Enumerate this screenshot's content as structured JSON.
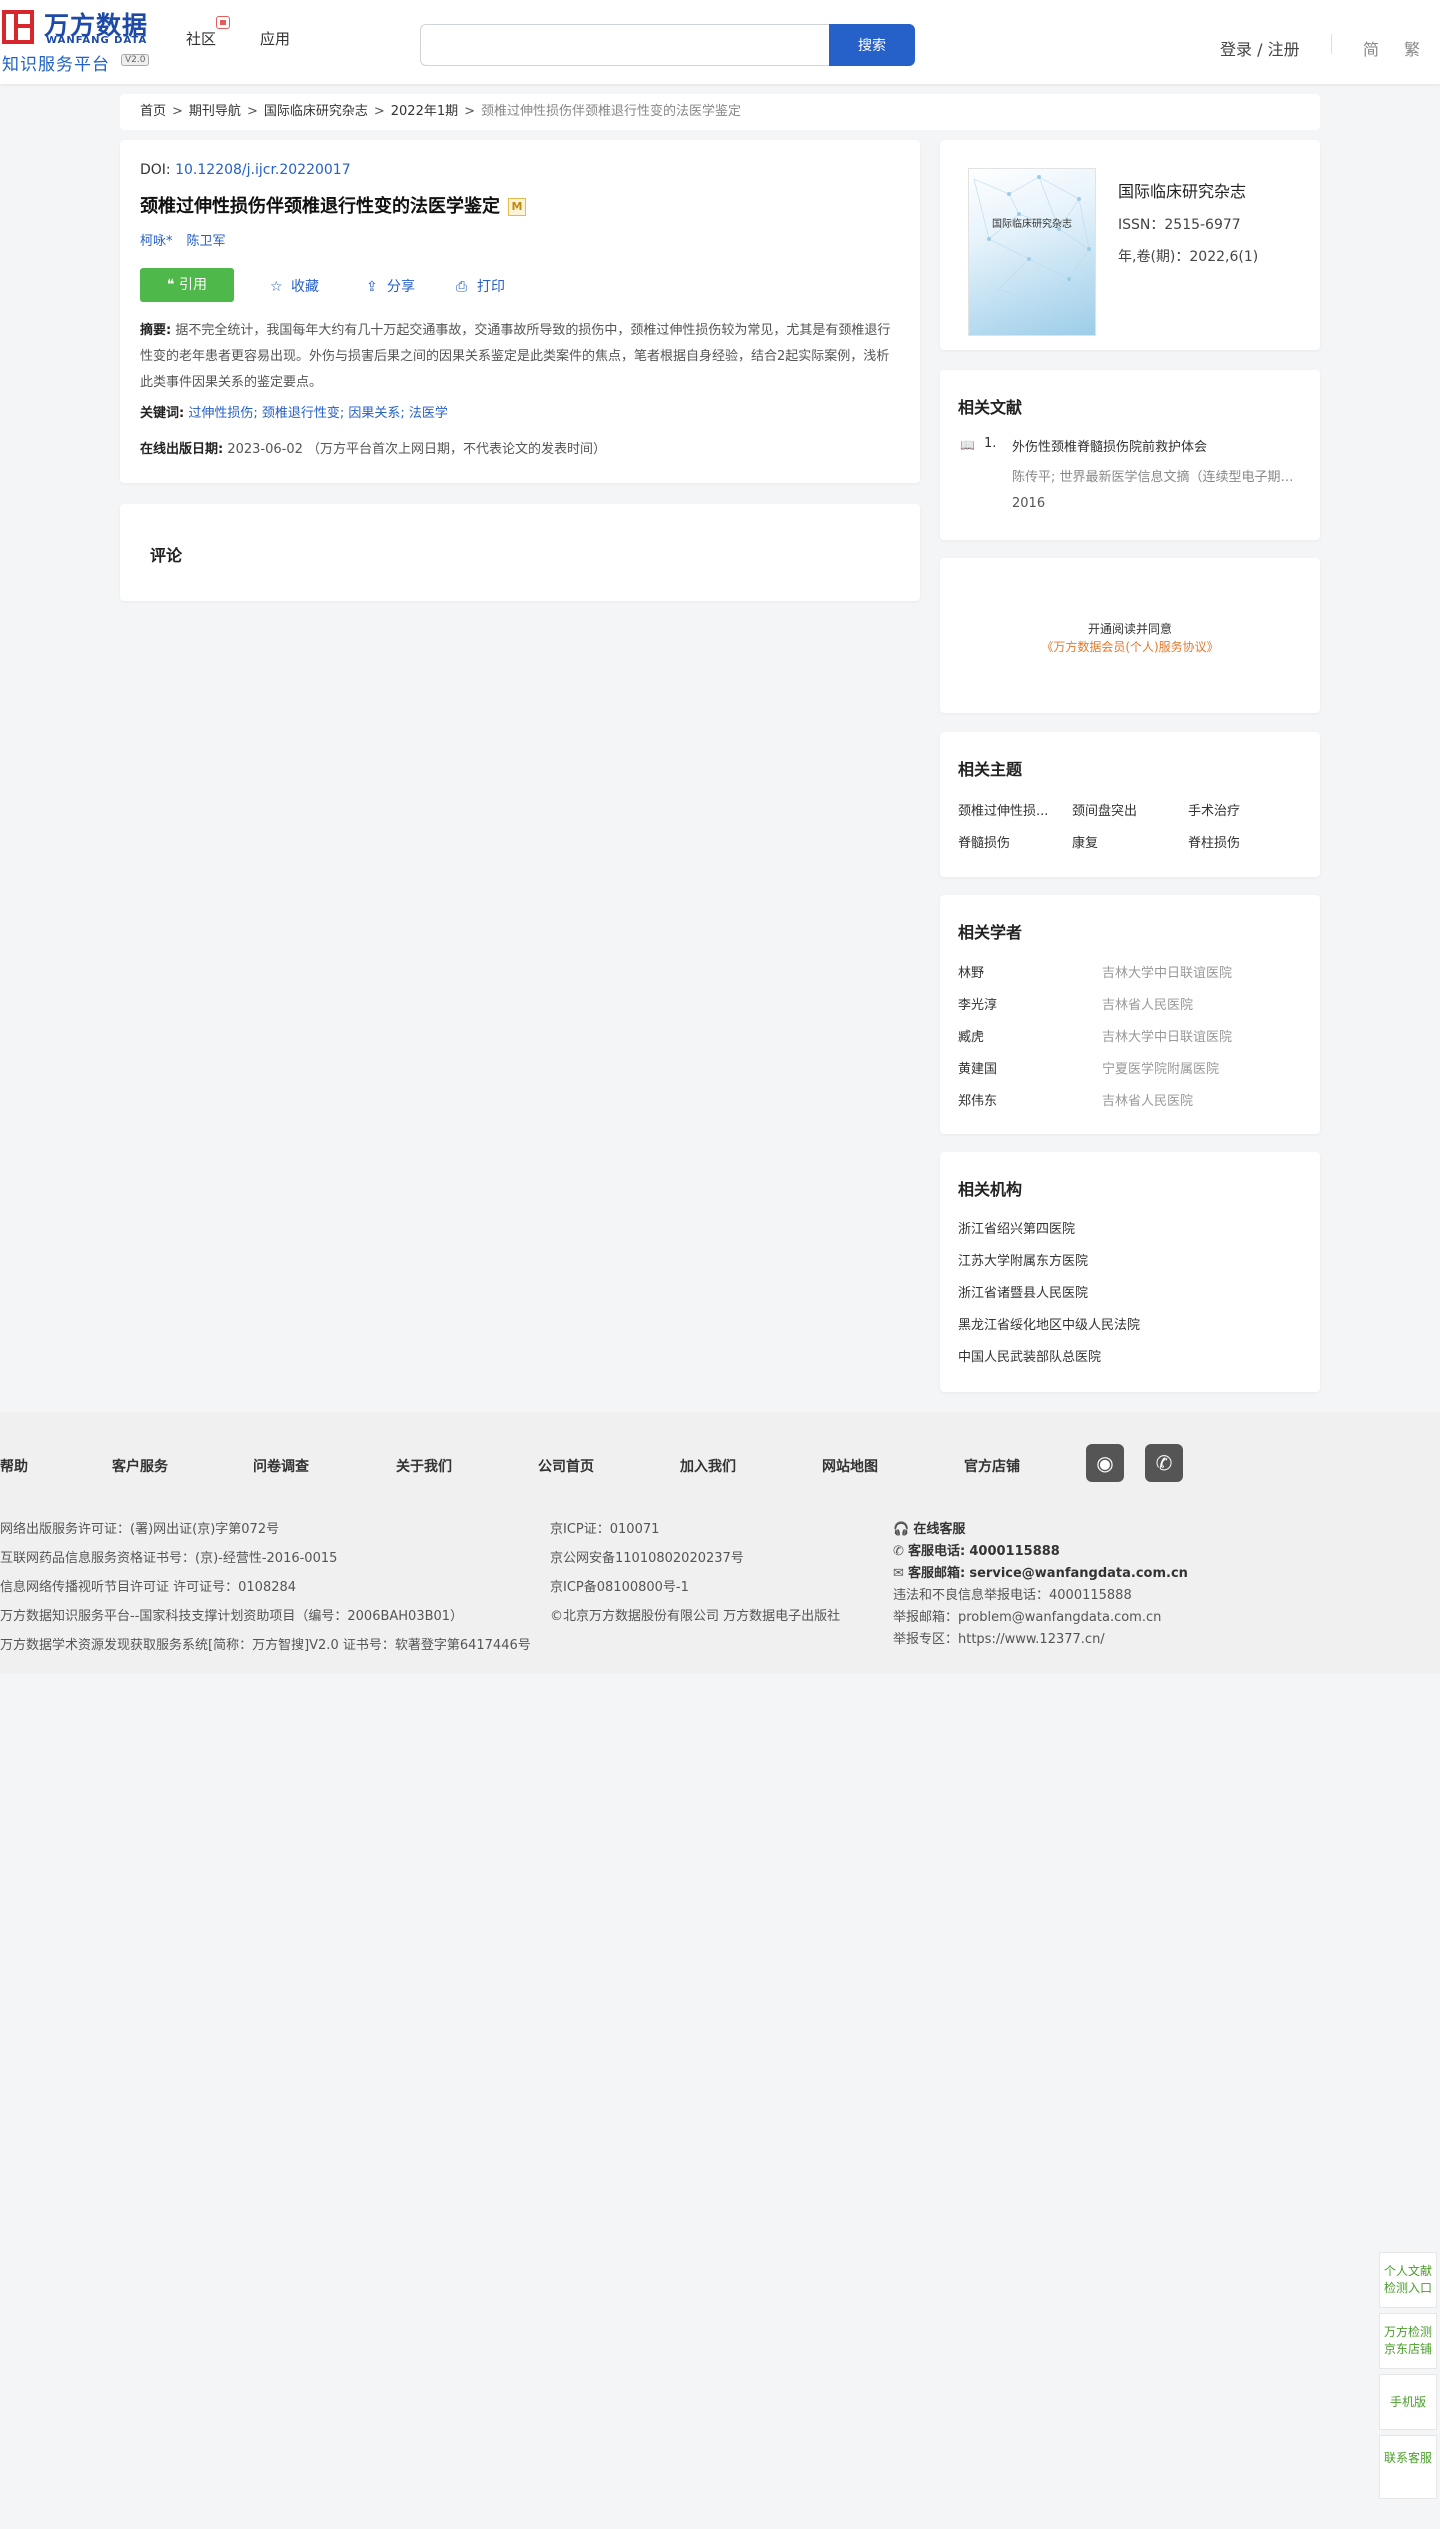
{
  "header": {
    "logo_cn": "万方数据",
    "logo_en": "WANFANG DATA",
    "logo_sub": "知识服务平台",
    "logo_ver": "V2.0",
    "nav": [
      "社区",
      "应用"
    ],
    "search_placeholder": "",
    "search_button": "搜索",
    "login": "登录 / 注册",
    "lang_simplified": "简",
    "lang_traditional": "繁"
  },
  "breadcrumb": [
    "首页",
    "期刊导航",
    "国际临床研究杂志",
    "2022年1期"
  ],
  "breadcrumb_current": "颈椎过伸性损伤伴颈椎退行性变的法医学鉴定",
  "breadcrumb_sep": ">",
  "article": {
    "doi_label": "DOI:",
    "doi": "10.12208/j.ijcr.20220017",
    "title": "颈椎过伸性损伤伴颈椎退行性变的法医学鉴定",
    "badge": "M",
    "authors": [
      "柯咏*",
      "陈卫军"
    ],
    "cite_label": "❝ 引用",
    "actions": [
      "收藏",
      "分享",
      "打印"
    ],
    "abstract_label": "摘要:",
    "abstract": "据不完全统计，我国每年大约有几十万起交通事故，交通事故所导致的损伤中，颈椎过伸性损伤较为常见，尤其是有颈椎退行性变的老年患者更容易出现。外伤与损害后果之间的因果关系鉴定是此类案件的焦点，笔者根据自身经验，结合2起实际案例，浅析此类事件因果关系的鉴定要点。",
    "keywords_label": "关键词:",
    "keywords": "过伸性损伤; 颈椎退行性变; 因果关系; 法医学",
    "pubdate_label": "在线出版日期:",
    "pubdate": "2023-06-02",
    "pubdate_note": "（万方平台首次上网日期，不代表论文的发表时间）"
  },
  "comment": {
    "title": "评论"
  },
  "journal": {
    "cover_text": "国际临床研究杂志",
    "name": "国际临床研究杂志",
    "issn": "ISSN：2515-6977",
    "volume": "年,卷(期)：2022,6(1)"
  },
  "related_docs": {
    "title": "相关文献",
    "items": [
      {
        "num": "1.",
        "title": "外伤性颈椎脊髓损伤院前救护体会",
        "meta": "陈传平; 世界最新医学信息文摘（连续型电子期刊）",
        "year": "2016"
      }
    ]
  },
  "agreement": {
    "line1": "开通阅读并同意",
    "line2": "《万方数据会员(个人)服务协议》"
  },
  "topics": {
    "title": "相关主题",
    "items": [
      "颈椎过伸性损...",
      "颈间盘突出",
      "手术治疗",
      "脊髓损伤",
      "康复",
      "脊柱损伤"
    ]
  },
  "scholars": {
    "title": "相关学者",
    "items": [
      {
        "name": "林野",
        "org": "吉林大学中日联谊医院"
      },
      {
        "name": "李光淳",
        "org": "吉林省人民医院"
      },
      {
        "name": "臧虎",
        "org": "吉林大学中日联谊医院"
      },
      {
        "name": "黄建国",
        "org": "宁夏医学院附属医院"
      },
      {
        "name": "郑伟东",
        "org": "吉林省人民医院"
      }
    ]
  },
  "institutions": {
    "title": "相关机构",
    "items": [
      "浙江省绍兴第四医院",
      "江苏大学附属东方医院",
      "浙江省诸暨县人民医院",
      "黑龙江省绥化地区中级人民法院",
      "中国人民武装部队总医院"
    ]
  },
  "footer": {
    "links": [
      "帮助",
      "客户服务",
      "问卷调查",
      "关于我们",
      "公司首页",
      "加入我们",
      "网站地图",
      "官方店铺"
    ],
    "col1": [
      "网络出版服务许可证：(署)网出证(京)字第072号",
      "互联网药品信息服务资格证书号：(京)-经营性-2016-0015",
      "信息网络传播视听节目许可证 许可证号：0108284",
      "万方数据知识服务平台--国家科技支撑计划资助项目（编号：2006BAH03B01）",
      "万方数据学术资源发现获取服务系统[简称：万方智搜]V2.0 证书号：软著登字第6417446号"
    ],
    "col2": [
      "京ICP证：010071",
      "京公网安备11010802020237号",
      "京ICP备08100800号-1",
      "©北京万方数据股份有限公司 万方数据电子出版社"
    ],
    "online_service": "在线客服",
    "phone_label": "客服电话:",
    "phone": "4000115888",
    "email_label": "客服邮箱:",
    "email": "service@wanfangdata.com.cn",
    "report_phone": "违法和不良信息举报电话：4000115888",
    "report_email": "举报邮箱：problem@wanfangdata.com.cn",
    "report_zone": "举报专区：https://www.12377.cn/"
  },
  "float": {
    "item1": "个人文献检测入口",
    "item2": "万方检测京东店铺",
    "item3": "手机版",
    "item4": "联系客服"
  }
}
